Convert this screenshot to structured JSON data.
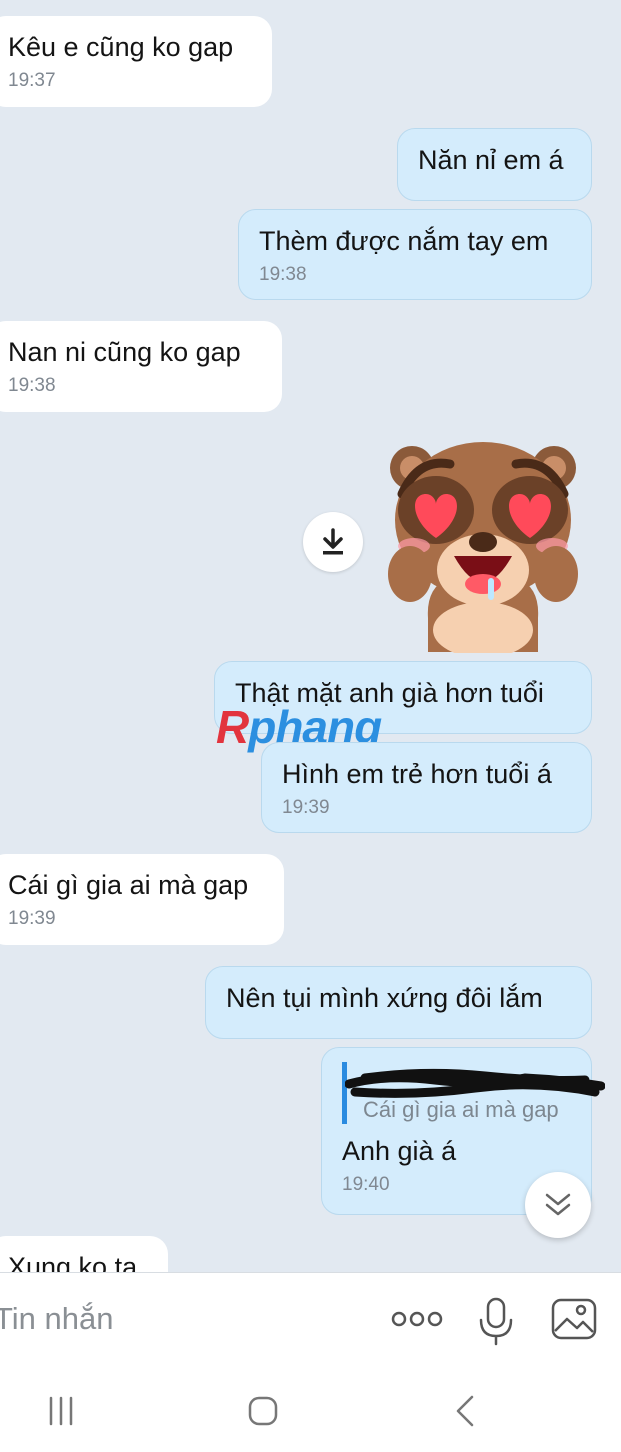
{
  "messages": [
    {
      "direction": "incoming",
      "text": "Kêu e cũng ko gap",
      "time": "19:37"
    },
    {
      "direction": "outgoing",
      "text": "Năn nỉ em á",
      "time": ""
    },
    {
      "direction": "outgoing",
      "text": "Thèm được nắm tay em",
      "time": "19:38"
    },
    {
      "direction": "incoming",
      "text": "Nan ni cũng ko gap",
      "time": "19:38"
    },
    {
      "direction": "outgoing",
      "type": "sticker",
      "sticker": "bear-heart-eyes-sticker"
    },
    {
      "direction": "outgoing",
      "text": "Thật mặt anh già hơn tuổi",
      "time": ""
    },
    {
      "direction": "outgoing",
      "text": "Hình em trẻ hơn tuổi á",
      "time": "19:39"
    },
    {
      "direction": "incoming",
      "text": "Cái gì gia ai mà gap",
      "time": "19:39"
    },
    {
      "direction": "outgoing",
      "text": "Nên tụi mình xứng đôi lắm",
      "time": ""
    },
    {
      "direction": "outgoing",
      "text": "Anh già á",
      "time": "19:40",
      "quote": "Cái gì gia ai mà gap"
    },
    {
      "direction": "incoming",
      "text": "Xung ko ta",
      "time": ""
    }
  ],
  "watermark": {
    "part_a": "R",
    "part_b": "phang"
  },
  "input": {
    "placeholder": "Tin nhắn"
  },
  "colors": {
    "outgoing_bubble": "#d4ecfc",
    "incoming_bubble": "#ffffff",
    "chat_background": "#e2e9f1",
    "quote_bar": "#2a8be0"
  },
  "icons": [
    "download-icon",
    "scroll-down-icon",
    "more-icon",
    "microphone-icon",
    "image-icon",
    "recent-apps-icon",
    "home-icon",
    "back-icon"
  ]
}
